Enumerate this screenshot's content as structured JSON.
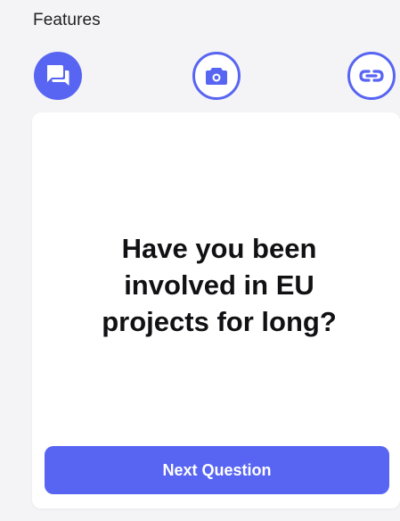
{
  "features": {
    "title": "Features",
    "icons": [
      {
        "name": "chat-icon",
        "active": true
      },
      {
        "name": "camera-icon",
        "active": false
      },
      {
        "name": "link-icon",
        "active": false
      }
    ]
  },
  "card": {
    "question": "Have you been involved in EU projects for long?",
    "next_label": "Next Question"
  },
  "colors": {
    "accent": "#5865f2",
    "background": "#f4f4f6",
    "card": "#ffffff",
    "text": "#111114"
  }
}
